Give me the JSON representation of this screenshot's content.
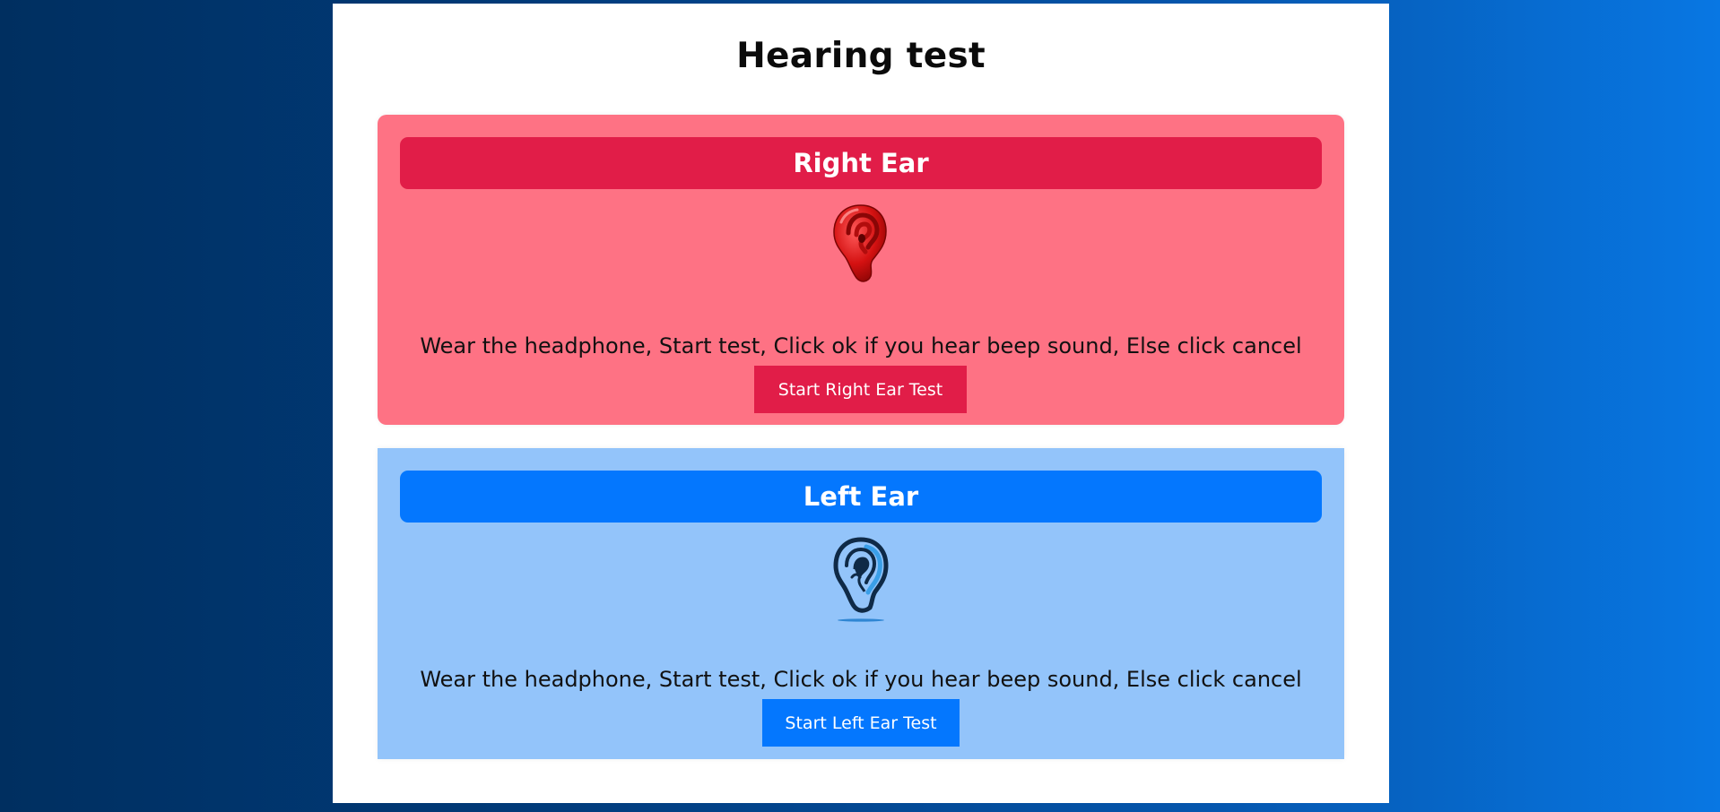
{
  "page": {
    "title": "Hearing test"
  },
  "right_ear": {
    "heading": "Right Ear",
    "icon": "ear-icon",
    "instructions": "Wear the headphone, Start test, Click ok if you hear beep sound, Else click cancel",
    "button_label": "Start Right Ear Test",
    "accent_color": "#e11d48",
    "background_color": "#fe7284"
  },
  "left_ear": {
    "heading": "Left Ear",
    "icon": "ear-icon",
    "instructions": "Wear the headphone, Start test, Click ok if you hear beep sound, Else click cancel",
    "button_label": "Start Left Ear Test",
    "accent_color": "#0477fe",
    "background_color": "#93c4fa"
  }
}
